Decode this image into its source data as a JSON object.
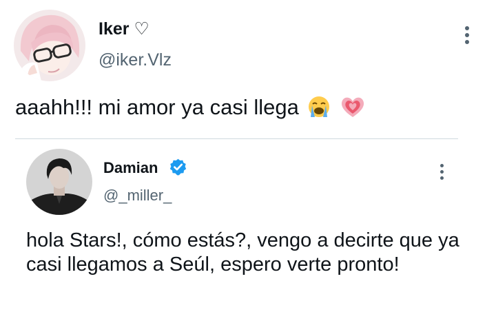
{
  "tweet": {
    "author": {
      "name": "Iker ♡",
      "handle": "@iker.Vlz",
      "avatar_icon": "avatar-pink-hair-glasses"
    },
    "text": "aaahh!!! mi amor ya casi llega",
    "emojis": [
      "loudly-crying-face-emoji",
      "growing-heart-emoji"
    ],
    "more_icon": "more-vertical-icon"
  },
  "quoted_tweet": {
    "author": {
      "name": "Damian",
      "handle": "@_miller_",
      "verified": true,
      "verified_color": "#1d9bf0",
      "avatar_icon": "avatar-dark-hair"
    },
    "text": "hola Stars!, cómo estás?, vengo a decirte que ya casi llegamos a Seúl, espero verte pronto!",
    "more_icon": "more-vertical-icon"
  },
  "colors": {
    "text": "#0f1419",
    "secondary": "#536471",
    "divider": "#cfd9de"
  }
}
